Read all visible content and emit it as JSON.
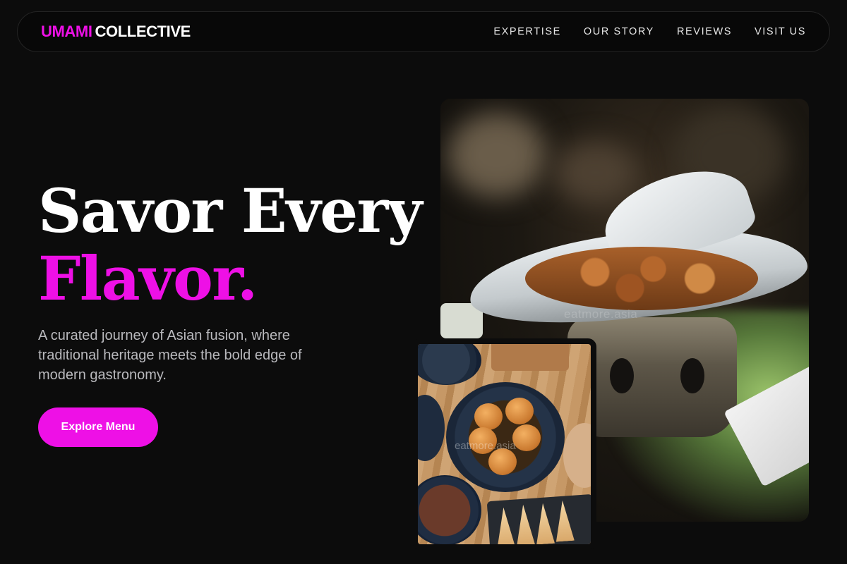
{
  "brand": {
    "accent": "UMAMI",
    "rest": "COLLECTIVE"
  },
  "nav": {
    "items": [
      {
        "label": "EXPERTISE"
      },
      {
        "label": "OUR STORY"
      },
      {
        "label": "REVIEWS"
      },
      {
        "label": "VISIT US"
      }
    ]
  },
  "hero": {
    "title_line1": "Savor Every",
    "title_line2": "Flavor.",
    "subtitle": "A curated journey of Asian fusion, where traditional heritage meets the bold edge of modern gastronomy.",
    "cta_label": "Explore Menu"
  },
  "images": {
    "main_watermark": "eatmore.asia",
    "second_watermark": "eatmore.asia"
  },
  "colors": {
    "accent": "#ee10e6",
    "background": "#0c0c0c",
    "nav_background": "#080808",
    "body_text": "#b9b9bd"
  }
}
